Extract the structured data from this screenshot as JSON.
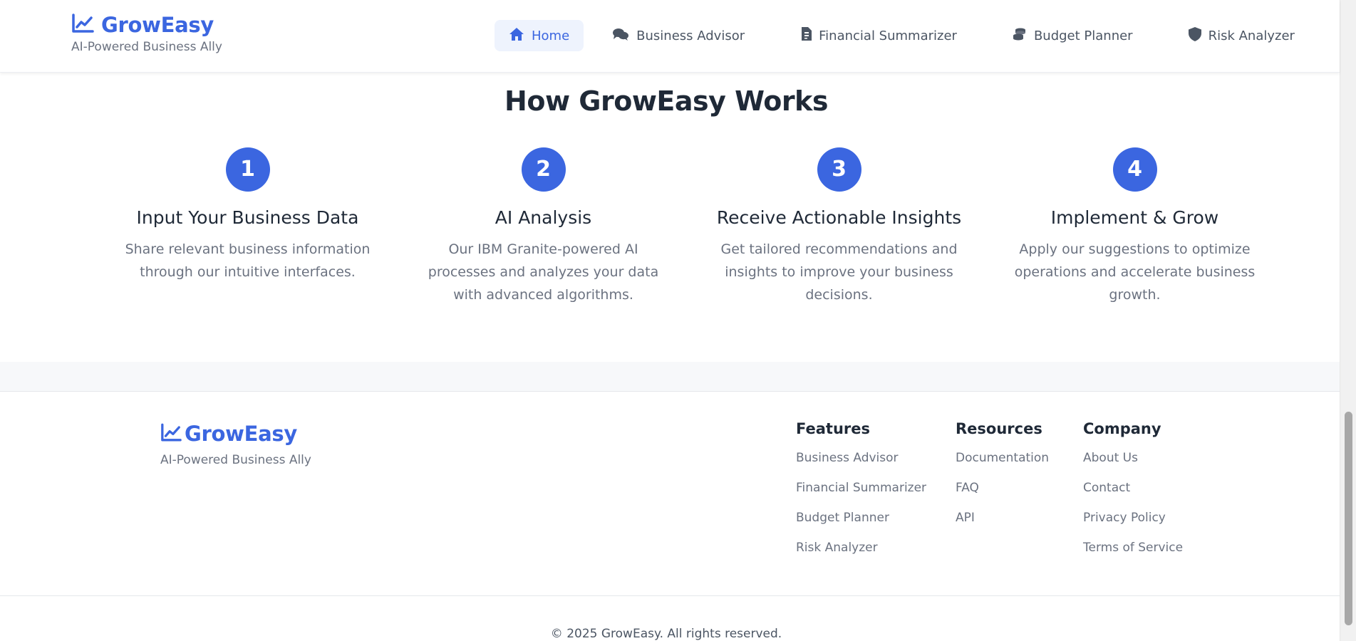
{
  "header": {
    "brand": {
      "title": "GrowEasy",
      "subtitle": "AI-Powered Business Ally",
      "icon": "chart-line-icon"
    },
    "nav": [
      {
        "label": "Home",
        "icon": "home-icon",
        "active": true
      },
      {
        "label": "Business Advisor",
        "icon": "comments-icon"
      },
      {
        "label": "Financial Summarizer",
        "icon": "file-invoice-icon"
      },
      {
        "label": "Budget Planner",
        "icon": "coins-icon"
      },
      {
        "label": "Risk Analyzer",
        "icon": "shield-icon"
      }
    ]
  },
  "how": {
    "title": "How GrowEasy Works",
    "steps": [
      {
        "number": "1",
        "title": "Input Your Business Data",
        "desc": "Share relevant business information through our intuitive interfaces."
      },
      {
        "number": "2",
        "title": "AI Analysis",
        "desc": "Our IBM Granite-powered AI processes and analyzes your data with advanced algorithms."
      },
      {
        "number": "3",
        "title": "Receive Actionable Insights",
        "desc": "Get tailored recommendations and insights to improve your business decisions."
      },
      {
        "number": "4",
        "title": "Implement & Grow",
        "desc": "Apply our suggestions to optimize operations and accelerate business growth."
      }
    ]
  },
  "footer": {
    "brand": {
      "title": "GrowEasy",
      "subtitle": "AI-Powered Business Ally"
    },
    "columns": [
      {
        "heading": "Features",
        "links": [
          "Business Advisor",
          "Financial Summarizer",
          "Budget Planner",
          "Risk Analyzer"
        ]
      },
      {
        "heading": "Resources",
        "links": [
          "Documentation",
          "FAQ",
          "API"
        ]
      },
      {
        "heading": "Company",
        "links": [
          "About Us",
          "Contact",
          "Privacy Policy",
          "Terms of Service"
        ]
      }
    ],
    "copyright": "© 2025 GrowEasy. All rights reserved."
  },
  "colors": {
    "accent": "#3b66e0",
    "text": "#1f2937",
    "muted": "#6b7280"
  }
}
